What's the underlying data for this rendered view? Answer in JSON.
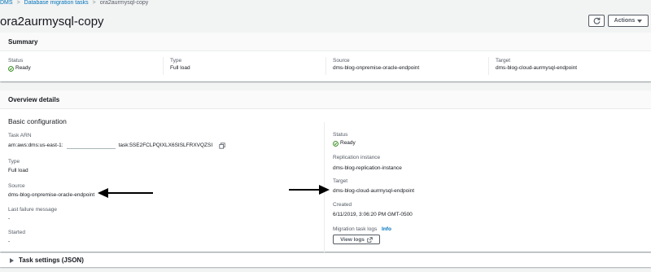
{
  "breadcrumb": {
    "root": "DMS",
    "section": "Database migration tasks",
    "current": "ora2aurmysql-copy"
  },
  "page": {
    "title": "ora2aurmysql-copy"
  },
  "toolbar": {
    "actions_label": "Actions"
  },
  "summary": {
    "title": "Summary",
    "status_label": "Status",
    "status_value": "Ready",
    "type_label": "Type",
    "type_value": "Full load",
    "source_label": "Source",
    "source_value": "dms-blog-onpremise-oracle-endpoint",
    "target_label": "Target",
    "target_value": "dms-blog-cloud-aurmysql-endpoint"
  },
  "overview": {
    "title": "Overview details",
    "subheading": "Basic configuration",
    "left": {
      "task_arn_label": "Task ARN",
      "task_arn_prefix": "arn:aws:dms:us-east-1:",
      "task_arn_suffix": "task:5SE2FCLPQIXLX6SISLFRXVQZSI",
      "type_label": "Type",
      "type_value": "Full load",
      "source_label": "Source",
      "source_value": "dms-blog-onpremise-oracle-endpoint",
      "last_failure_label": "Last failure message",
      "last_failure_value": "-",
      "started_label": "Started",
      "started_value": "-"
    },
    "right": {
      "status_label": "Status",
      "status_value": "Ready",
      "replication_label": "Replication instance",
      "replication_value": "dms-blog-replication-instance",
      "target_label": "Target",
      "target_value": "dms-blog-cloud-aurmysql-endpoint",
      "created_label": "Created",
      "created_value": "6/11/2019, 3:06:20 PM GMT-0500",
      "logs_label": "Migration task logs",
      "info_link": "Info",
      "view_logs_label": "View logs"
    }
  },
  "task_settings": {
    "label": "Task settings (JSON)"
  },
  "colors": {
    "link": "#0073bb",
    "success": "#1d8102",
    "border": "#eaeded",
    "text": "#16191f",
    "muted": "#545b64"
  }
}
